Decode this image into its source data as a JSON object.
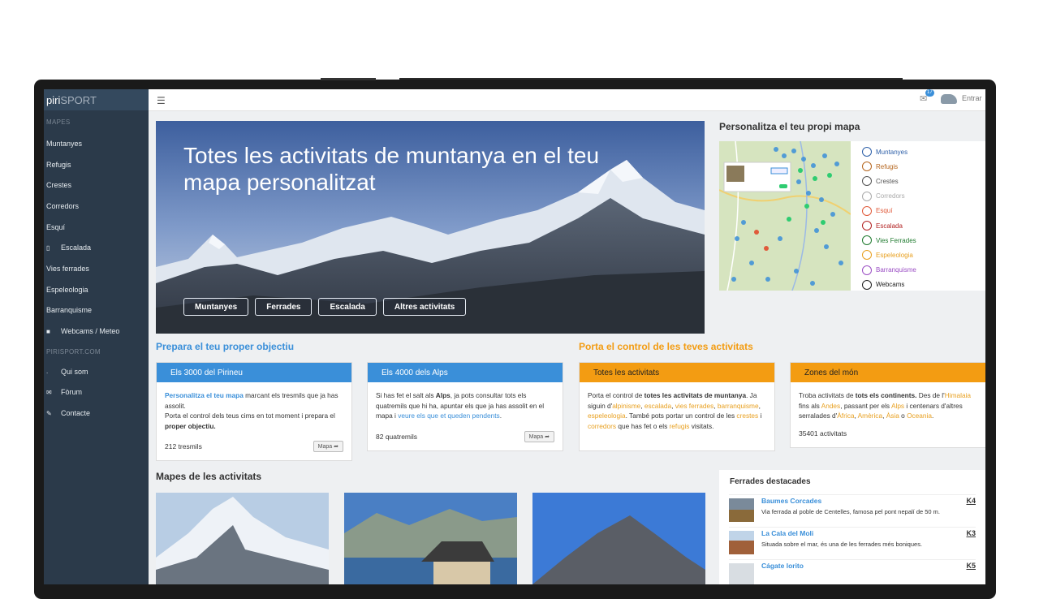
{
  "brand": {
    "part1": "piri",
    "part2": "SPORT"
  },
  "sidebar": {
    "head_maps": "MAPES",
    "items": [
      {
        "label": "Muntanyes",
        "icon": ""
      },
      {
        "label": "Refugis",
        "icon": ""
      },
      {
        "label": "Crestes",
        "icon": ""
      },
      {
        "label": "Corredors",
        "icon": ""
      },
      {
        "label": "Esquí",
        "icon": ""
      },
      {
        "label": "Escalada",
        "icon": "climb-icon"
      },
      {
        "label": "Vies ferrades",
        "icon": ""
      },
      {
        "label": "Espeleologia",
        "icon": ""
      },
      {
        "label": "Barranquisme",
        "icon": ""
      },
      {
        "label": "Webcams / Meteo",
        "icon": "video-camera-icon"
      }
    ],
    "head_site": "PIRISPORT.COM",
    "site_items": [
      {
        "label": "Qui som",
        "icon": "info-icon"
      },
      {
        "label": "Fòrum",
        "icon": "envelope-icon"
      },
      {
        "label": "Contacte",
        "icon": "edit-icon"
      }
    ]
  },
  "topbar": {
    "notifications": "17",
    "login": "Entrar"
  },
  "hero": {
    "title": "Totes les activitats de muntanya en el teu mapa personalitzat",
    "buttons": [
      "Muntanyes",
      "Ferrades",
      "Escalada",
      "Altres activitats"
    ]
  },
  "map_panel": {
    "title": "Personalitza el teu propi mapa",
    "legend": [
      {
        "label": "Muntanyes",
        "color": "#2d5fa8"
      },
      {
        "label": "Refugis",
        "color": "#b5651d"
      },
      {
        "label": "Crestes",
        "color": "#555555"
      },
      {
        "label": "Corredors",
        "color": "#aaaaaa"
      },
      {
        "label": "Esquí",
        "color": "#e05a3a"
      },
      {
        "label": "Escalada",
        "color": "#b22222"
      },
      {
        "label": "Vies Ferrades",
        "color": "#1e7a2e"
      },
      {
        "label": "Espeleologia",
        "color": "#e8a020"
      },
      {
        "label": "Barranquisme",
        "color": "#9b4fc4"
      },
      {
        "label": "Webcams",
        "color": "#222222"
      }
    ]
  },
  "sections": {
    "prepare": "Prepara el teu proper objectiu",
    "control": "Porta el control de les teves activitats",
    "maps": "Mapes de les activitats"
  },
  "cards": {
    "c1": {
      "header": "Els 3000 del Pirineu",
      "link": "Personalitza el teu mapa",
      "t1": " marcant els tresmils que ja has assolit.",
      "t2": "Porta el control dels teus cims en tot moment i prepara el ",
      "bold": "proper objectiu.",
      "count": "212 tresmils",
      "btn": "Mapa"
    },
    "c2": {
      "header": "Els 4000 dels Alps",
      "t1": "Si has fet el salt als ",
      "bold": "Alps",
      "t2": ", ja pots consultar tots els quatremils que hi ha, apuntar els que ja has assolit en el mapa i ",
      "link": "veure els que et queden pendents",
      "t3": ".",
      "count": "82 quatremils",
      "btn": "Mapa"
    },
    "c3": {
      "header": "Totes les activitats",
      "t1": "Porta el control de ",
      "bold": "totes les activitats de muntanya",
      "t2": ". Ja siguin d'",
      "l1": "alpinisme",
      "s1": ", ",
      "l2": "escalada",
      "s2": ", ",
      "l3": "vies ferrades",
      "s3": ", ",
      "l4": "barranquisme",
      "s4": ", ",
      "l5": "espeleologia",
      "t3": ". També pots portar un control de les ",
      "l6": "crestes",
      "s5": " i ",
      "l7": "corredors",
      "t4": " que has fet o els ",
      "l8": "refugis",
      "t5": " visitats."
    },
    "c4": {
      "header": "Zones del món",
      "t1": "Troba activitats de ",
      "bold": "tots els continents.",
      "t2": " Des de l'",
      "l1": "Himalaia",
      "t3": " fins als ",
      "l2": "Andes",
      "t4": ", passant per els ",
      "l3": "Alps",
      "t5": " i centenars d'altres serralades d'",
      "l4": "Àfrica",
      "s1": ", ",
      "l5": "Amèrica",
      "s2": ", ",
      "l6": "Àsia",
      "s3": " o ",
      "l7": "Oceania",
      "t6": ".",
      "count": "35401 activitats"
    }
  },
  "ferrades": {
    "title": "Ferrades destacades",
    "items": [
      {
        "name": "Baumes Corcades",
        "desc": "Via ferrada al poble de Centelles, famosa pel pont nepalí de 50 m.",
        "grade": "K4"
      },
      {
        "name": "La Cala del Moli",
        "desc": "Situada sobre el mar, és una de les ferrades més boniques.",
        "grade": "K3"
      },
      {
        "name": "Cágate lorito",
        "desc": "",
        "grade": "K5"
      }
    ]
  },
  "colors": {
    "blue": "#3a8fd9",
    "orange": "#f39c12",
    "sidebar": "#2b3a4a"
  }
}
